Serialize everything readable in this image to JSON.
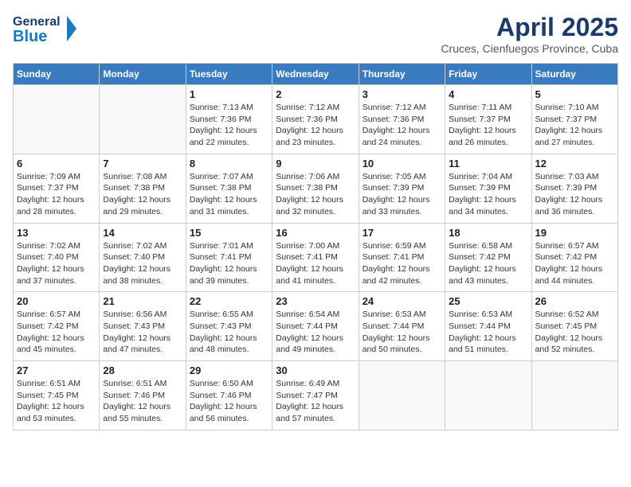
{
  "header": {
    "logo_general": "General",
    "logo_blue": "Blue",
    "title": "April 2025",
    "subtitle": "Cruces, Cienfuegos Province, Cuba"
  },
  "weekdays": [
    "Sunday",
    "Monday",
    "Tuesday",
    "Wednesday",
    "Thursday",
    "Friday",
    "Saturday"
  ],
  "weeks": [
    [
      {
        "day": "",
        "info": ""
      },
      {
        "day": "",
        "info": ""
      },
      {
        "day": "1",
        "info": "Sunrise: 7:13 AM\nSunset: 7:36 PM\nDaylight: 12 hours and 22 minutes."
      },
      {
        "day": "2",
        "info": "Sunrise: 7:12 AM\nSunset: 7:36 PM\nDaylight: 12 hours and 23 minutes."
      },
      {
        "day": "3",
        "info": "Sunrise: 7:12 AM\nSunset: 7:36 PM\nDaylight: 12 hours and 24 minutes."
      },
      {
        "day": "4",
        "info": "Sunrise: 7:11 AM\nSunset: 7:37 PM\nDaylight: 12 hours and 26 minutes."
      },
      {
        "day": "5",
        "info": "Sunrise: 7:10 AM\nSunset: 7:37 PM\nDaylight: 12 hours and 27 minutes."
      }
    ],
    [
      {
        "day": "6",
        "info": "Sunrise: 7:09 AM\nSunset: 7:37 PM\nDaylight: 12 hours and 28 minutes."
      },
      {
        "day": "7",
        "info": "Sunrise: 7:08 AM\nSunset: 7:38 PM\nDaylight: 12 hours and 29 minutes."
      },
      {
        "day": "8",
        "info": "Sunrise: 7:07 AM\nSunset: 7:38 PM\nDaylight: 12 hours and 31 minutes."
      },
      {
        "day": "9",
        "info": "Sunrise: 7:06 AM\nSunset: 7:38 PM\nDaylight: 12 hours and 32 minutes."
      },
      {
        "day": "10",
        "info": "Sunrise: 7:05 AM\nSunset: 7:39 PM\nDaylight: 12 hours and 33 minutes."
      },
      {
        "day": "11",
        "info": "Sunrise: 7:04 AM\nSunset: 7:39 PM\nDaylight: 12 hours and 34 minutes."
      },
      {
        "day": "12",
        "info": "Sunrise: 7:03 AM\nSunset: 7:39 PM\nDaylight: 12 hours and 36 minutes."
      }
    ],
    [
      {
        "day": "13",
        "info": "Sunrise: 7:02 AM\nSunset: 7:40 PM\nDaylight: 12 hours and 37 minutes."
      },
      {
        "day": "14",
        "info": "Sunrise: 7:02 AM\nSunset: 7:40 PM\nDaylight: 12 hours and 38 minutes."
      },
      {
        "day": "15",
        "info": "Sunrise: 7:01 AM\nSunset: 7:41 PM\nDaylight: 12 hours and 39 minutes."
      },
      {
        "day": "16",
        "info": "Sunrise: 7:00 AM\nSunset: 7:41 PM\nDaylight: 12 hours and 41 minutes."
      },
      {
        "day": "17",
        "info": "Sunrise: 6:59 AM\nSunset: 7:41 PM\nDaylight: 12 hours and 42 minutes."
      },
      {
        "day": "18",
        "info": "Sunrise: 6:58 AM\nSunset: 7:42 PM\nDaylight: 12 hours and 43 minutes."
      },
      {
        "day": "19",
        "info": "Sunrise: 6:57 AM\nSunset: 7:42 PM\nDaylight: 12 hours and 44 minutes."
      }
    ],
    [
      {
        "day": "20",
        "info": "Sunrise: 6:57 AM\nSunset: 7:42 PM\nDaylight: 12 hours and 45 minutes."
      },
      {
        "day": "21",
        "info": "Sunrise: 6:56 AM\nSunset: 7:43 PM\nDaylight: 12 hours and 47 minutes."
      },
      {
        "day": "22",
        "info": "Sunrise: 6:55 AM\nSunset: 7:43 PM\nDaylight: 12 hours and 48 minutes."
      },
      {
        "day": "23",
        "info": "Sunrise: 6:54 AM\nSunset: 7:44 PM\nDaylight: 12 hours and 49 minutes."
      },
      {
        "day": "24",
        "info": "Sunrise: 6:53 AM\nSunset: 7:44 PM\nDaylight: 12 hours and 50 minutes."
      },
      {
        "day": "25",
        "info": "Sunrise: 6:53 AM\nSunset: 7:44 PM\nDaylight: 12 hours and 51 minutes."
      },
      {
        "day": "26",
        "info": "Sunrise: 6:52 AM\nSunset: 7:45 PM\nDaylight: 12 hours and 52 minutes."
      }
    ],
    [
      {
        "day": "27",
        "info": "Sunrise: 6:51 AM\nSunset: 7:45 PM\nDaylight: 12 hours and 53 minutes."
      },
      {
        "day": "28",
        "info": "Sunrise: 6:51 AM\nSunset: 7:46 PM\nDaylight: 12 hours and 55 minutes."
      },
      {
        "day": "29",
        "info": "Sunrise: 6:50 AM\nSunset: 7:46 PM\nDaylight: 12 hours and 56 minutes."
      },
      {
        "day": "30",
        "info": "Sunrise: 6:49 AM\nSunset: 7:47 PM\nDaylight: 12 hours and 57 minutes."
      },
      {
        "day": "",
        "info": ""
      },
      {
        "day": "",
        "info": ""
      },
      {
        "day": "",
        "info": ""
      }
    ]
  ]
}
